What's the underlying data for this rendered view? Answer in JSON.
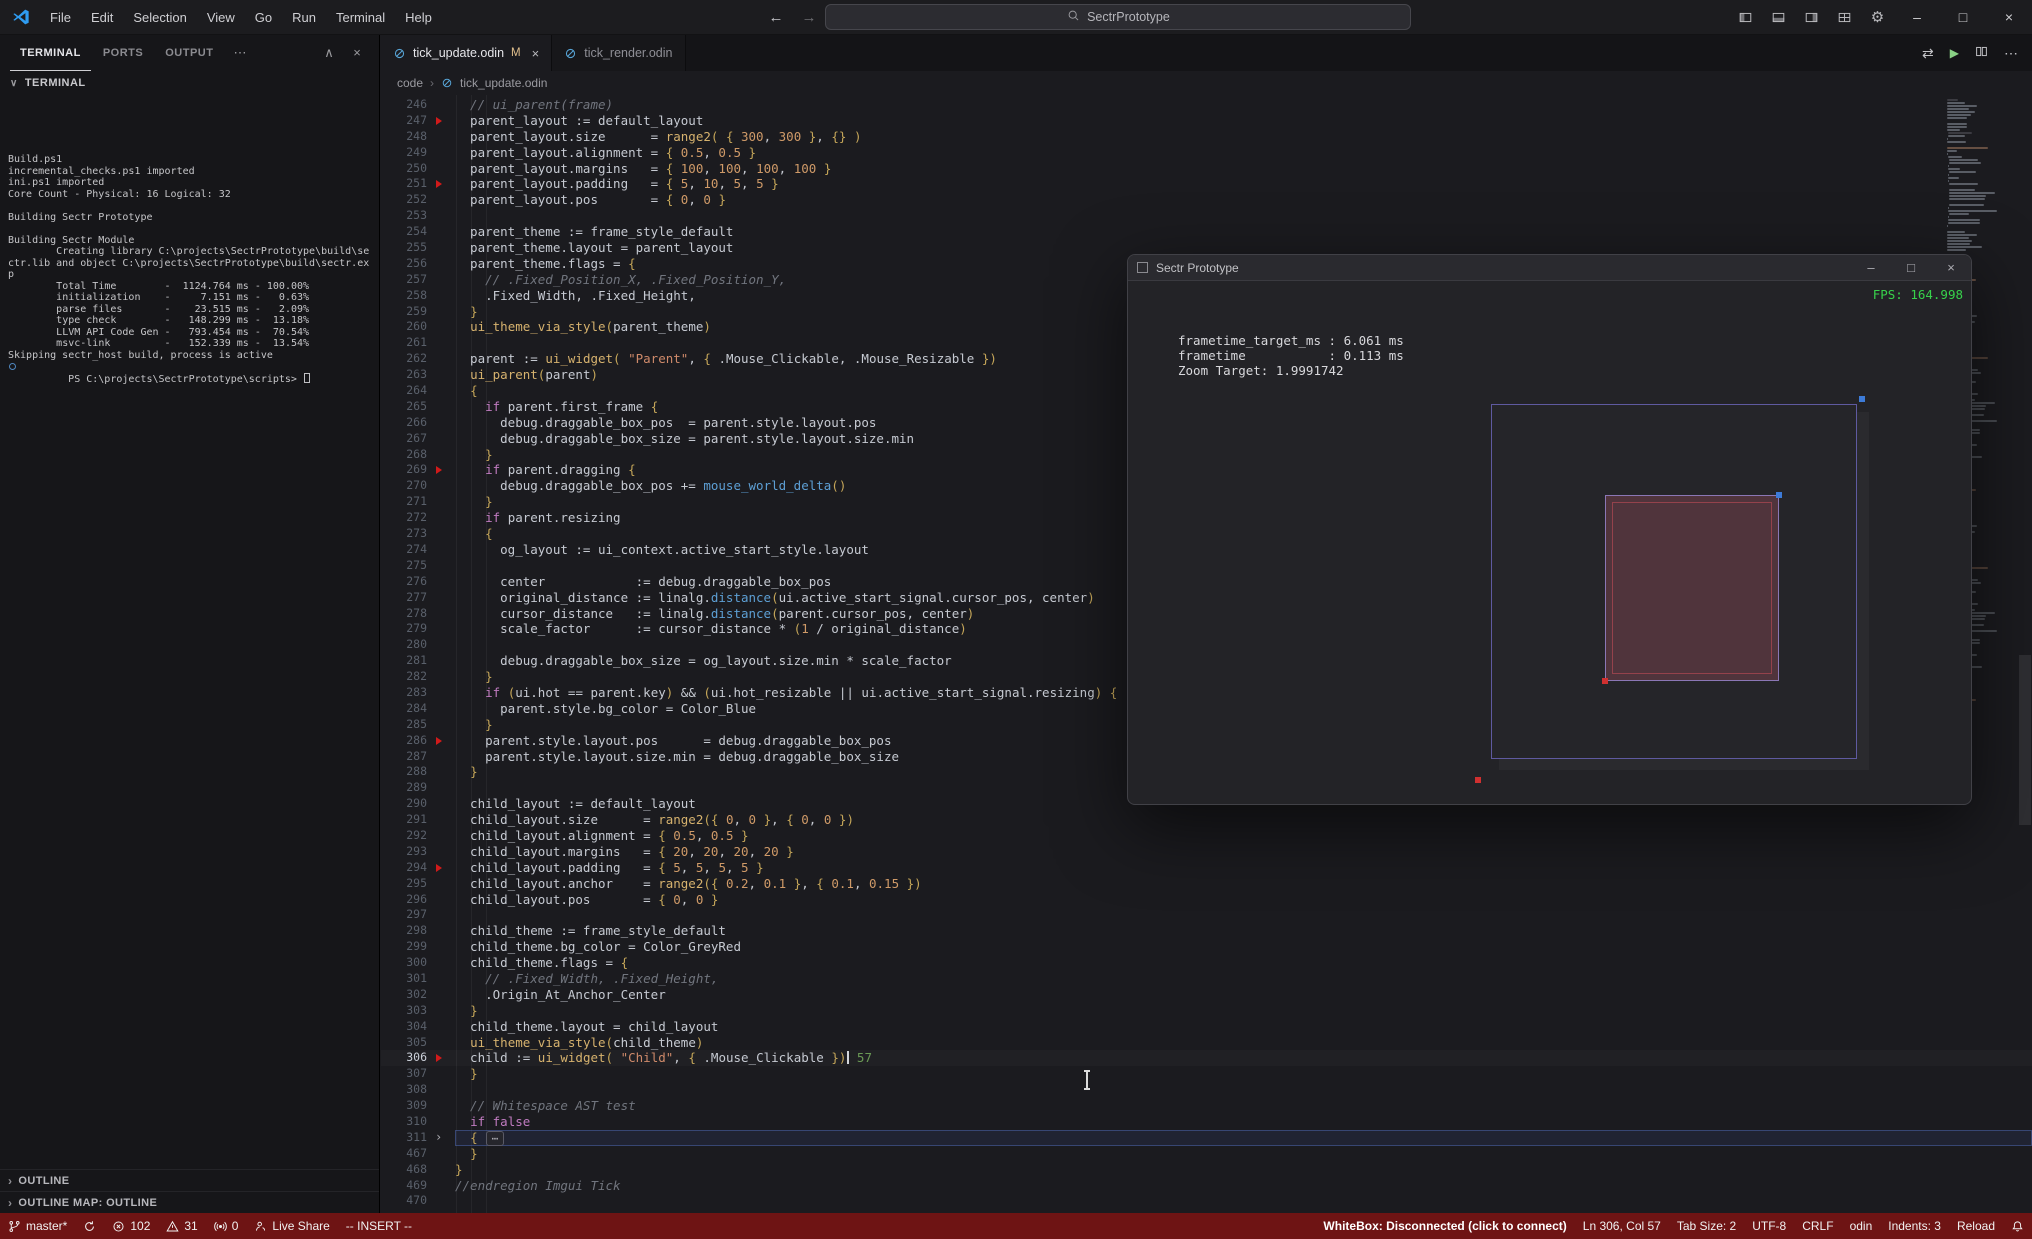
{
  "titlebar": {
    "menus": [
      "File",
      "Edit",
      "Selection",
      "View",
      "Go",
      "Run",
      "Terminal",
      "Help"
    ],
    "search_text": "SectrPrototype",
    "back_arrow": "←",
    "forward_arrow": "→",
    "layout_icons": [
      "layout-sidebar-left-icon",
      "layout-panel-icon",
      "layout-sidebar-right-icon",
      "layout-customize-icon"
    ],
    "gear_glyph": "⚙",
    "window_controls": [
      {
        "name": "minimize-button",
        "glyph": "–"
      },
      {
        "name": "maximize-button",
        "glyph": "□"
      },
      {
        "name": "close-button",
        "glyph": "×"
      }
    ]
  },
  "panel": {
    "tabs": [
      {
        "label": "TERMINAL",
        "active": true
      },
      {
        "label": "PORTS",
        "active": false
      },
      {
        "label": "OUTPUT",
        "active": false
      }
    ],
    "overflow_glyph": "⋯",
    "actions": [
      {
        "name": "panel-maximize-icon",
        "glyph": "∧"
      },
      {
        "name": "panel-close-icon",
        "glyph": "×"
      }
    ],
    "view_header": "TERMINAL",
    "view_header_chevron": "∨",
    "terminal_lines": [
      "Build.ps1",
      "incremental_checks.ps1 imported",
      "ini.ps1 imported",
      "Core Count - Physical: 16 Logical: 32",
      "",
      "Building Sectr Prototype",
      "",
      "Building Sectr Module",
      "        Creating library C:\\projects\\SectrPrototype\\build\\sectr.lib and object C:\\projects\\SectrPrototype\\build\\sectr.exp",
      "        Total Time        -  1124.764 ms - 100.00%",
      "        initialization    -     7.151 ms -   0.63%",
      "        parse files       -    23.515 ms -   2.09%",
      "        type check        -   148.299 ms -  13.18%",
      "        LLVM API Code Gen -   793.454 ms -  70.54%",
      "        msvc-link         -   152.339 ms -  13.54%",
      "Skipping sectr_host build, process is active"
    ],
    "prompt": "PS C:\\projects\\SectrPrototype\\scripts> ",
    "outline_sections": [
      "OUTLINE",
      "OUTLINE MAP: OUTLINE"
    ]
  },
  "editor": {
    "tabs": [
      {
        "label": "tick_update.odin",
        "modified": "M",
        "close_glyph": "×",
        "active": true
      },
      {
        "label": "tick_render.odin",
        "modified": "",
        "close_glyph": "",
        "active": false
      }
    ],
    "actions": [
      {
        "name": "toggle-changes-icon",
        "glyph": "⇄"
      },
      {
        "name": "run-file-icon",
        "glyph": "▶"
      },
      {
        "name": "split-editor-icon",
        "glyph": ""
      },
      {
        "name": "more-actions-icon",
        "glyph": "⋯"
      }
    ],
    "breadcrumb": {
      "root": "code",
      "chevron": "›",
      "file": "tick_update.odin"
    },
    "active_line": 306,
    "cursor_line": 306,
    "inline_hint": "57",
    "deleted_markers": [
      247,
      251,
      269,
      286,
      294,
      306
    ],
    "fold_chevron": "›",
    "fold_badge": "⋯",
    "lines": [
      {
        "n": 246,
        "t": "  // ui_parent(frame)"
      },
      {
        "n": 247,
        "t": "  parent_layout := default_layout"
      },
      {
        "n": 248,
        "t": "  parent_layout.size      = range2( { 300, 300 }, {} )"
      },
      {
        "n": 249,
        "t": "  parent_layout.alignment = { 0.5, 0.5 }"
      },
      {
        "n": 250,
        "t": "  parent_layout.margins   = { 100, 100, 100, 100 }"
      },
      {
        "n": 251,
        "t": "  parent_layout.padding   = { 5, 10, 5, 5 }"
      },
      {
        "n": 252,
        "t": "  parent_layout.pos       = { 0, 0 }"
      },
      {
        "n": 253,
        "t": ""
      },
      {
        "n": 254,
        "t": "  parent_theme := frame_style_default"
      },
      {
        "n": 255,
        "t": "  parent_theme.layout = parent_layout"
      },
      {
        "n": 256,
        "t": "  parent_theme.flags = {"
      },
      {
        "n": 257,
        "t": "    // .Fixed_Position_X, .Fixed_Position_Y,"
      },
      {
        "n": 258,
        "t": "    .Fixed_Width, .Fixed_Height,"
      },
      {
        "n": 259,
        "t": "  }"
      },
      {
        "n": 260,
        "t": "  ui_theme_via_style(parent_theme)"
      },
      {
        "n": 261,
        "t": ""
      },
      {
        "n": 262,
        "t": "  parent := ui_widget( \"Parent\", { .Mouse_Clickable, .Mouse_Resizable })"
      },
      {
        "n": 263,
        "t": "  ui_parent(parent)"
      },
      {
        "n": 264,
        "t": "  {"
      },
      {
        "n": 265,
        "t": "    if parent.first_frame {"
      },
      {
        "n": 266,
        "t": "      debug.draggable_box_pos  = parent.style.layout.pos"
      },
      {
        "n": 267,
        "t": "      debug.draggable_box_size = parent.style.layout.size.min"
      },
      {
        "n": 268,
        "t": "    }"
      },
      {
        "n": 269,
        "t": "    if parent.dragging {"
      },
      {
        "n": 270,
        "t": "      debug.draggable_box_pos += mouse_world_delta()"
      },
      {
        "n": 271,
        "t": "    }"
      },
      {
        "n": 272,
        "t": "    if parent.resizing"
      },
      {
        "n": 273,
        "t": "    {"
      },
      {
        "n": 274,
        "t": "      og_layout := ui_context.active_start_style.layout"
      },
      {
        "n": 275,
        "t": ""
      },
      {
        "n": 276,
        "t": "      center            := debug.draggable_box_pos"
      },
      {
        "n": 277,
        "t": "      original_distance := linalg.distance(ui.active_start_signal.cursor_pos, center)"
      },
      {
        "n": 278,
        "t": "      cursor_distance   := linalg.distance(parent.cursor_pos, center)"
      },
      {
        "n": 279,
        "t": "      scale_factor      := cursor_distance * (1 / original_distance)"
      },
      {
        "n": 280,
        "t": ""
      },
      {
        "n": 281,
        "t": "      debug.draggable_box_size = og_layout.size.min * scale_factor"
      },
      {
        "n": 282,
        "t": "    }"
      },
      {
        "n": 283,
        "t": "    if (ui.hot == parent.key) && (ui.hot_resizable || ui.active_start_signal.resizing) {"
      },
      {
        "n": 284,
        "t": "      parent.style.bg_color = Color_Blue"
      },
      {
        "n": 285,
        "t": "    }"
      },
      {
        "n": 286,
        "t": "    parent.style.layout.pos      = debug.draggable_box_pos"
      },
      {
        "n": 287,
        "t": "    parent.style.layout.size.min = debug.draggable_box_size"
      },
      {
        "n": 288,
        "t": "  }"
      },
      {
        "n": 289,
        "t": ""
      },
      {
        "n": 290,
        "t": "  child_layout := default_layout"
      },
      {
        "n": 291,
        "t": "  child_layout.size      = range2({ 0, 0 }, { 0, 0 })"
      },
      {
        "n": 292,
        "t": "  child_layout.alignment = { 0.5, 0.5 }"
      },
      {
        "n": 293,
        "t": "  child_layout.margins   = { 20, 20, 20, 20 }"
      },
      {
        "n": 294,
        "t": "  child_layout.padding   = { 5, 5, 5, 5 }"
      },
      {
        "n": 295,
        "t": "  child_layout.anchor    = range2({ 0.2, 0.1 }, { 0.1, 0.15 })"
      },
      {
        "n": 296,
        "t": "  child_layout.pos       = { 0, 0 }"
      },
      {
        "n": 297,
        "t": ""
      },
      {
        "n": 298,
        "t": "  child_theme := frame_style_default"
      },
      {
        "n": 299,
        "t": "  child_theme.bg_color = Color_GreyRed"
      },
      {
        "n": 300,
        "t": "  child_theme.flags = {"
      },
      {
        "n": 301,
        "t": "    // .Fixed_Width, .Fixed_Height,"
      },
      {
        "n": 302,
        "t": "    .Origin_At_Anchor_Center"
      },
      {
        "n": 303,
        "t": "  }"
      },
      {
        "n": 304,
        "t": "  child_theme.layout = child_layout"
      },
      {
        "n": 305,
        "t": "  ui_theme_via_style(child_theme)"
      },
      {
        "n": 306,
        "t": "  child := ui_widget( \"Child\", { .Mouse_Clickable })"
      },
      {
        "n": 307,
        "t": "  }"
      },
      {
        "n": 308,
        "t": ""
      },
      {
        "n": 309,
        "t": "  // Whitespace AST test"
      },
      {
        "n": 310,
        "t": "  if false"
      },
      {
        "n": 311,
        "t": "  {",
        "fold": true
      },
      {
        "n": 467,
        "t": "  }"
      },
      {
        "n": 468,
        "t": "}"
      },
      {
        "n": 469,
        "t": "//endregion Imgui Tick"
      },
      {
        "n": 470,
        "t": ""
      }
    ]
  },
  "overlay": {
    "title": "Sectr Prototype",
    "fps": "FPS: 164.998",
    "stats": [
      "frametime_target_ms : 6.061 ms",
      "frametime           : 0.113 ms",
      "Zoom Target: 1.9991742"
    ],
    "window_controls": [
      {
        "name": "prototype-minimize-button",
        "glyph": "–"
      },
      {
        "name": "prototype-maximize-button",
        "glyph": "□"
      },
      {
        "name": "prototype-close-button",
        "glyph": "×"
      }
    ]
  },
  "statusbar": {
    "left": [
      {
        "name": "git-branch",
        "icon": "branch-icon",
        "text": "master*"
      },
      {
        "name": "git-sync",
        "icon": "sync-icon",
        "text": ""
      },
      {
        "name": "problems-errors",
        "icon": "error-icon",
        "text": "102"
      },
      {
        "name": "problems-warnings",
        "icon": "warning-icon",
        "text": "31"
      },
      {
        "name": "forwarded-ports",
        "icon": "broadcast-icon",
        "text": "0"
      },
      {
        "name": "live-share",
        "icon": "liveshare-icon",
        "text": "Live Share"
      },
      {
        "name": "vim-mode",
        "icon": "",
        "text": "-- INSERT --"
      }
    ],
    "right": [
      {
        "name": "whitebox-status",
        "icon": "",
        "text": "WhiteBox: Disconnected (click to connect)",
        "bold": true
      },
      {
        "name": "cursor-position",
        "icon": "",
        "text": "Ln 306, Col 57"
      },
      {
        "name": "tab-size",
        "icon": "",
        "text": "Tab Size: 2"
      },
      {
        "name": "encoding",
        "icon": "",
        "text": "UTF-8"
      },
      {
        "name": "eol-sequence",
        "icon": "",
        "text": "CRLF"
      },
      {
        "name": "language-mode",
        "icon": "",
        "text": "odin"
      },
      {
        "name": "indents",
        "icon": "",
        "text": "Indents: 3"
      },
      {
        "name": "reload",
        "icon": "",
        "text": "Reload"
      },
      {
        "name": "notifications",
        "icon": "bell-icon",
        "text": ""
      }
    ]
  },
  "colors": {
    "statusbar_bg": "#6e1414",
    "fps_green": "#37d24b",
    "accent_blue": "#3d7bd8",
    "marker_red": "#d11a1a"
  }
}
